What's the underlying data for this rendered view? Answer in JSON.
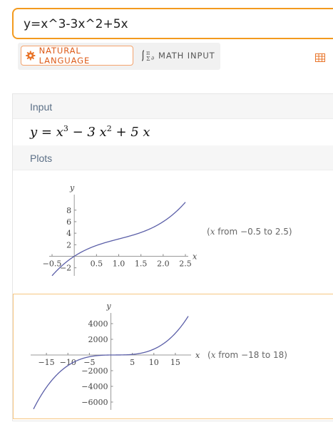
{
  "search": {
    "query": "y=x^3-3x^2+5x"
  },
  "modes": {
    "natural_language": "NATURAL LANGUAGE",
    "math_input": "MATH INPUT"
  },
  "pods": {
    "input": {
      "title": "Input",
      "formula": {
        "lhs": "y",
        "eq": " = ",
        "t1": "x",
        "e1": "3",
        "t2": " − 3 x",
        "e2": "2",
        "t3": " + 5 x"
      }
    },
    "plots": {
      "title": "Plots"
    }
  },
  "colors": {
    "accent": "#f39a1e",
    "curve": "#5b5fa8",
    "header_text": "#5b6f86"
  },
  "chart_data": [
    {
      "type": "line",
      "function": "x^3 - 3x^2 + 5x",
      "xlabel": "x",
      "ylabel": "y",
      "xlim": [
        -0.5,
        2.5
      ],
      "ylim": [
        -3.4,
        10.2
      ],
      "x_ticks": [
        -0.5,
        0.5,
        1.0,
        1.5,
        2.0,
        2.5
      ],
      "x_tick_labels": [
        "−0.5",
        "0.5",
        "1.0",
        "1.5",
        "2.0",
        "2.5"
      ],
      "y_ticks": [
        -2,
        2,
        4,
        6,
        8
      ],
      "y_tick_labels": [
        "−2",
        "2",
        "4",
        "6",
        "8"
      ],
      "range_text": {
        "pre": "(",
        "var": "x",
        "post": " from −0.5 to 2.5)"
      }
    },
    {
      "type": "line",
      "function": "x^3 - 3x^2 + 5x",
      "xlabel": "x",
      "ylabel": "y",
      "xlim": [
        -18,
        18
      ],
      "ylim": [
        -7000,
        5000
      ],
      "x_ticks": [
        -15,
        -10,
        -5,
        5,
        10,
        15
      ],
      "x_tick_labels": [
        "−15",
        "−10",
        "−5",
        "5",
        "10",
        "15"
      ],
      "y_ticks": [
        -6000,
        -4000,
        -2000,
        2000,
        4000
      ],
      "y_tick_labels": [
        "−6000",
        "−4000",
        "−2000",
        "2000",
        "4000"
      ],
      "range_text": {
        "pre": "(",
        "var": "x",
        "post": " from −18 to 18)"
      }
    }
  ]
}
